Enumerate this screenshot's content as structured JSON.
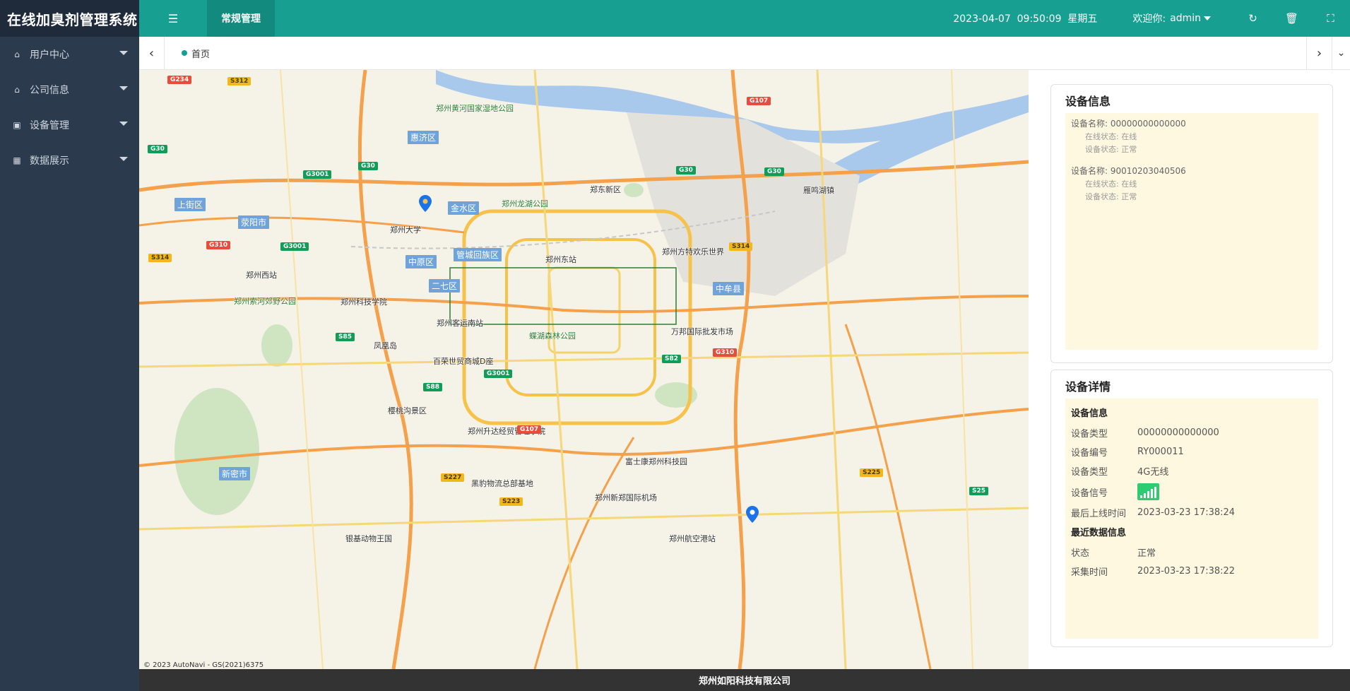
{
  "app": {
    "title": "在线加臭剂管理系统"
  },
  "sidebar": {
    "items": [
      {
        "label": "用户中心",
        "icon": "home-icon"
      },
      {
        "label": "公司信息",
        "icon": "home-icon"
      },
      {
        "label": "设备管理",
        "icon": "briefcase-icon"
      },
      {
        "label": "数据展示",
        "icon": "calendar-icon"
      }
    ]
  },
  "topbar": {
    "active_tab": "常规管理",
    "datetime": "2023-04-07  09:50:09  星期五",
    "welcome": "欢迎你:",
    "user": "admin"
  },
  "tabs": {
    "home": "首页"
  },
  "map": {
    "labels": {
      "zhengzhou_university": "郑州大学",
      "jinshui": "金水区",
      "guancheng": "管城回族区",
      "zhongyuan": "中原区",
      "erqi": "二七区",
      "huiji": "惠济区",
      "shangjie": "上街区",
      "xingyang": "荥阳市",
      "zhengdong": "郑东新区",
      "zhengzhou_east": "郑州东站",
      "zhengzhou_west": "郑州西站",
      "longhu_park": "郑州龙湖公园",
      "yellow_river_park": "郑州黄河国家湿地公园",
      "fangte": "郑州方特欢乐世界",
      "zhongmou": "中牟县",
      "xinzheng_airport": "郑州新郑国际机场",
      "foxconn": "富士康郑州科技园",
      "xinmi": "新密市",
      "keji_college": "郑州科技学院",
      "bus_station": "郑州客运南站",
      "dieyu_park": "蝶湖森林公园",
      "wanbang": "万邦国际批发市场",
      "suohe_park": "郑州索河郊野公园",
      "yinji_zoo": "银基动物王国",
      "shengdao": "郑州升达经贸管理学院",
      "logistics": "黑豹物流总部基地",
      "baiyi": "百荣世贸商城D座",
      "yinjiao": "樱桃沟景区",
      "hangkong": "郑州航空港站",
      "fengshan": "凤凰岛",
      "yanming": "雁鸣湖镇"
    },
    "attribution": "© 2023 AutoNavi - GS(2021)6375",
    "pin_color": "#1a73e8"
  },
  "panel_info": {
    "title": "设备信息",
    "devices": [
      {
        "name": "设备名称:  00000000000000",
        "online": "在线状态:  在线",
        "status": "设备状态:  正常"
      },
      {
        "name": "设备名称:  90010203040506",
        "online": "在线状态:  在线",
        "status": "设备状态:  正常"
      }
    ]
  },
  "panel_detail": {
    "title": "设备详情",
    "section1": "设备信息",
    "rows": [
      {
        "k": "设备类型",
        "v": "00000000000000"
      },
      {
        "k": "设备编号",
        "v": "RY000011"
      },
      {
        "k": "设备类型",
        "v": "4G无线"
      },
      {
        "k": "设备信号",
        "v": ""
      },
      {
        "k": "最后上线时间",
        "v": "2023-03-23 17:38:24"
      }
    ],
    "section2": "最近数据信息",
    "rows2": [
      {
        "k": "状态",
        "v": "正常"
      },
      {
        "k": "采集时间",
        "v": "2023-03-23 17:38:22"
      }
    ],
    "signal_color": "#2ecc71"
  },
  "footer": {
    "company": "郑州如阳科技有限公司"
  }
}
